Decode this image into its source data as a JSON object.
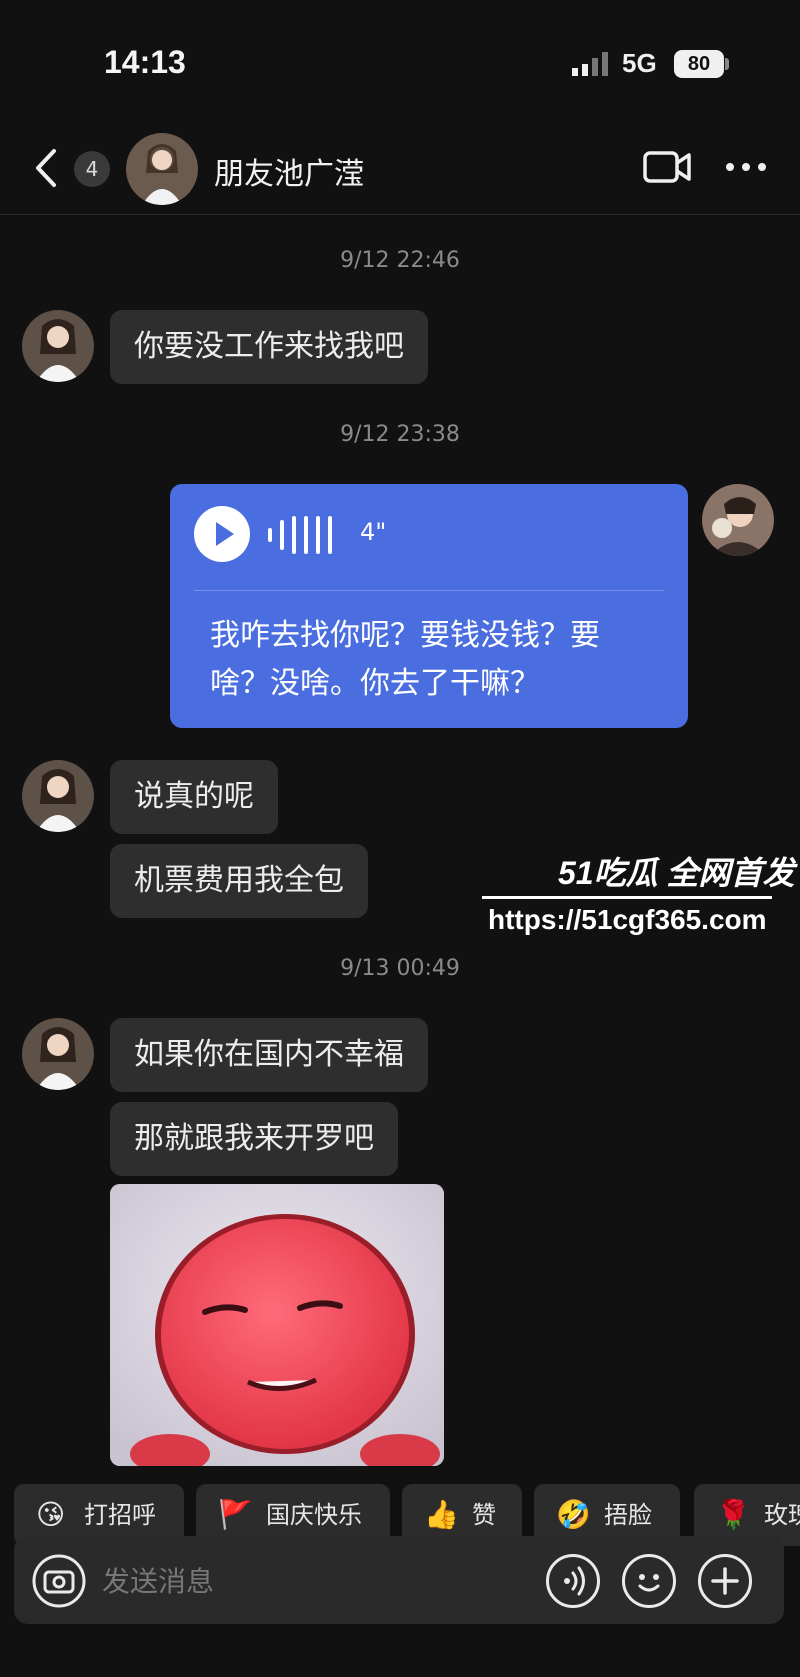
{
  "status_bar": {
    "time": "14:13",
    "network": "5G",
    "battery": "80"
  },
  "header": {
    "unread_count": "4",
    "contact_name": "朋友池广滢"
  },
  "messages": {
    "timestamp_1": "9/12 22:46",
    "msg_1": "你要没工作来找我吧",
    "timestamp_2": "9/12 23:38",
    "voice": {
      "duration": "4\"",
      "transcript": "我咋去找你呢？要钱没钱？要啥？没啥。你去了干嘛？"
    },
    "msg_2": "说真的呢",
    "msg_3": "机票费用我全包",
    "timestamp_3": "9/13 00:49",
    "msg_4": "如果你在国内不幸福",
    "msg_5": "那就跟我来开罗吧"
  },
  "watermark": {
    "brand": "51吃瓜 全网首发",
    "url": "https://51cgf365.com"
  },
  "quick_replies": [
    {
      "icon": "😘",
      "label": "打招呼"
    },
    {
      "icon": "🚩",
      "label": "国庆快乐"
    },
    {
      "icon": "👍",
      "label": "赞"
    },
    {
      "icon": "🤣",
      "label": "捂脸"
    },
    {
      "icon": "🌹",
      "label": "玫瑰"
    }
  ],
  "input": {
    "placeholder": "发送消息"
  },
  "colors": {
    "background": "#111111",
    "bubble_incoming": "#2e2e2e",
    "bubble_voice": "#4a6ee0"
  }
}
